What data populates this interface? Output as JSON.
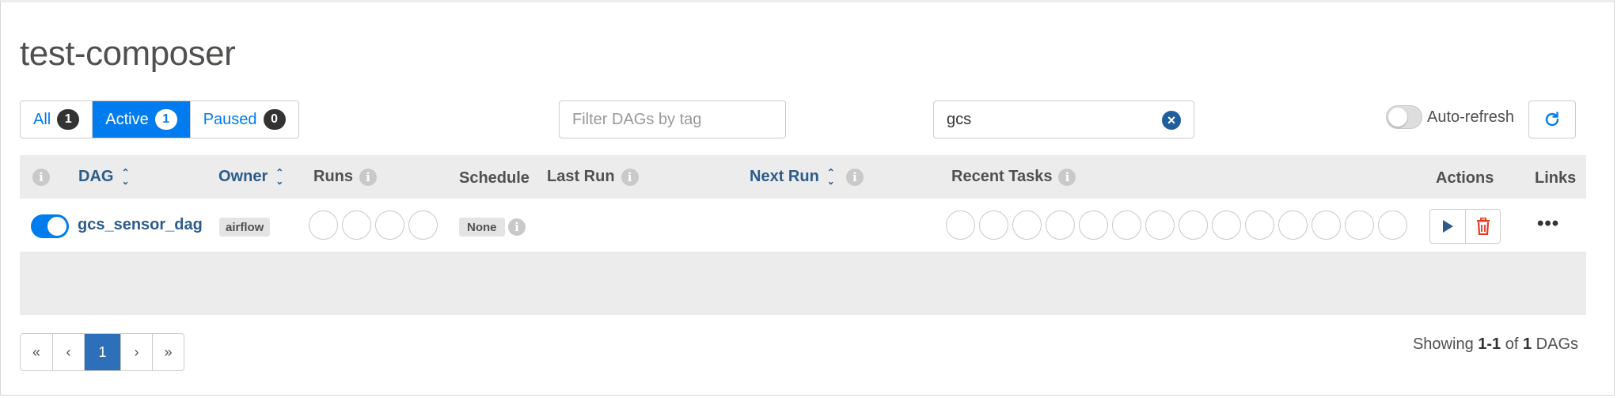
{
  "page": {
    "title": "test-composer"
  },
  "filters": {
    "all_label": "All",
    "all_count": "1",
    "active_label": "Active",
    "active_count": "1",
    "paused_label": "Paused",
    "paused_count": "0",
    "tag_placeholder": "Filter DAGs by tag",
    "search_value": "gcs",
    "auto_refresh_label": "Auto-refresh"
  },
  "table": {
    "headers": {
      "dag": "DAG",
      "owner": "Owner",
      "runs": "Runs",
      "schedule": "Schedule",
      "last_run": "Last Run",
      "next_run": "Next Run",
      "recent_tasks": "Recent Tasks",
      "actions": "Actions",
      "links": "Links"
    },
    "rows": [
      {
        "dag_id": "gcs_sensor_dag",
        "owner": "airflow",
        "schedule": "None",
        "paused": false,
        "runs_circles": 4,
        "task_circles": 14
      }
    ]
  },
  "pagination": {
    "first": "«",
    "prev": "‹",
    "current": "1",
    "next": "›",
    "last": "»"
  },
  "footer": {
    "showing_prefix": "Showing",
    "range": "1-1",
    "of": "of",
    "total": "1",
    "suffix": "DAGs"
  },
  "colors": {
    "primary": "#017cee",
    "link": "#2d5c8a",
    "danger": "#e43921"
  }
}
